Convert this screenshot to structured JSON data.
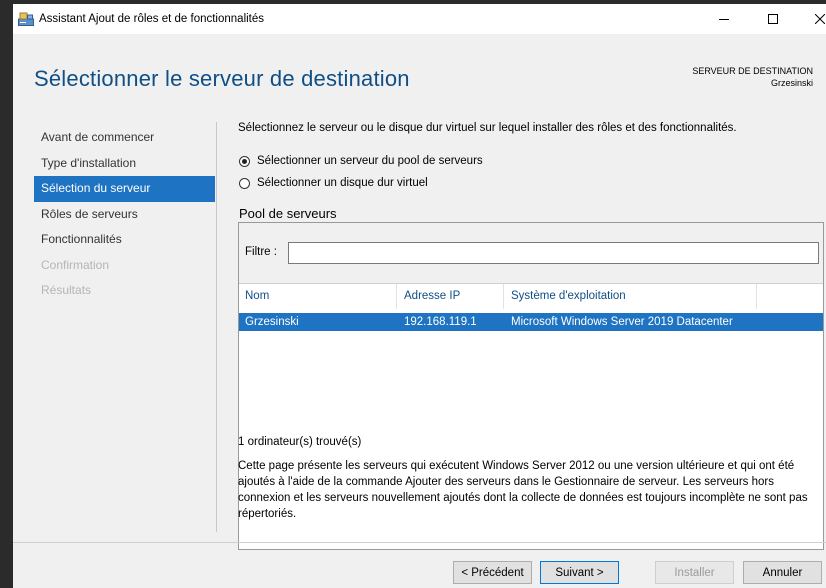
{
  "window": {
    "title": "Assistant Ajout de rôles et de fonctionnalités",
    "minimize_icon": "minimize-icon",
    "maximize_icon": "maximize-icon",
    "close_icon": "close-icon"
  },
  "header": {
    "title": "Sélectionner le serveur de destination",
    "dest_label": "SERVEUR DE DESTINATION",
    "dest_server": "Grzesinski"
  },
  "nav": {
    "items": [
      {
        "label": "Avant de commencer",
        "state": "normal"
      },
      {
        "label": "Type d'installation",
        "state": "normal"
      },
      {
        "label": "Sélection du serveur",
        "state": "active"
      },
      {
        "label": "Rôles de serveurs",
        "state": "normal"
      },
      {
        "label": "Fonctionnalités",
        "state": "normal"
      },
      {
        "label": "Confirmation",
        "state": "disabled"
      },
      {
        "label": "Résultats",
        "state": "disabled"
      }
    ]
  },
  "main": {
    "instruction": "Sélectionnez le serveur ou le disque dur virtuel sur lequel installer des rôles et des fonctionnalités.",
    "radio_pool": "Sélectionner un serveur du pool de serveurs",
    "radio_vhd": "Sélectionner un disque dur virtuel",
    "selected_option": "pool",
    "pool_title": "Pool de serveurs",
    "filter_label": "Filtre :",
    "filter_value": "",
    "columns": {
      "name": "Nom",
      "ip": "Adresse IP",
      "os": "Système d'exploitation"
    },
    "rows": [
      {
        "name": "Grzesinski",
        "ip": "192.168.119.1",
        "os": "Microsoft Windows Server 2019 Datacenter"
      }
    ],
    "found": "1 ordinateur(s) trouvé(s)",
    "description": "Cette page présente les serveurs qui exécutent Windows Server 2012 ou une version ultérieure et qui ont été ajoutés à l'aide de la commande Ajouter des serveurs dans le Gestionnaire de serveur. Les serveurs hors connexion et les serveurs nouvellement ajoutés dont la collecte de données est toujours incomplète ne sont pas répertoriés."
  },
  "footer": {
    "previous": "< Précédent",
    "next": "Suivant >",
    "install": "Installer",
    "cancel": "Annuler"
  },
  "colors": {
    "accent": "#1e73c2",
    "title": "#0f4f86",
    "disabled": "#b5b5b5"
  }
}
